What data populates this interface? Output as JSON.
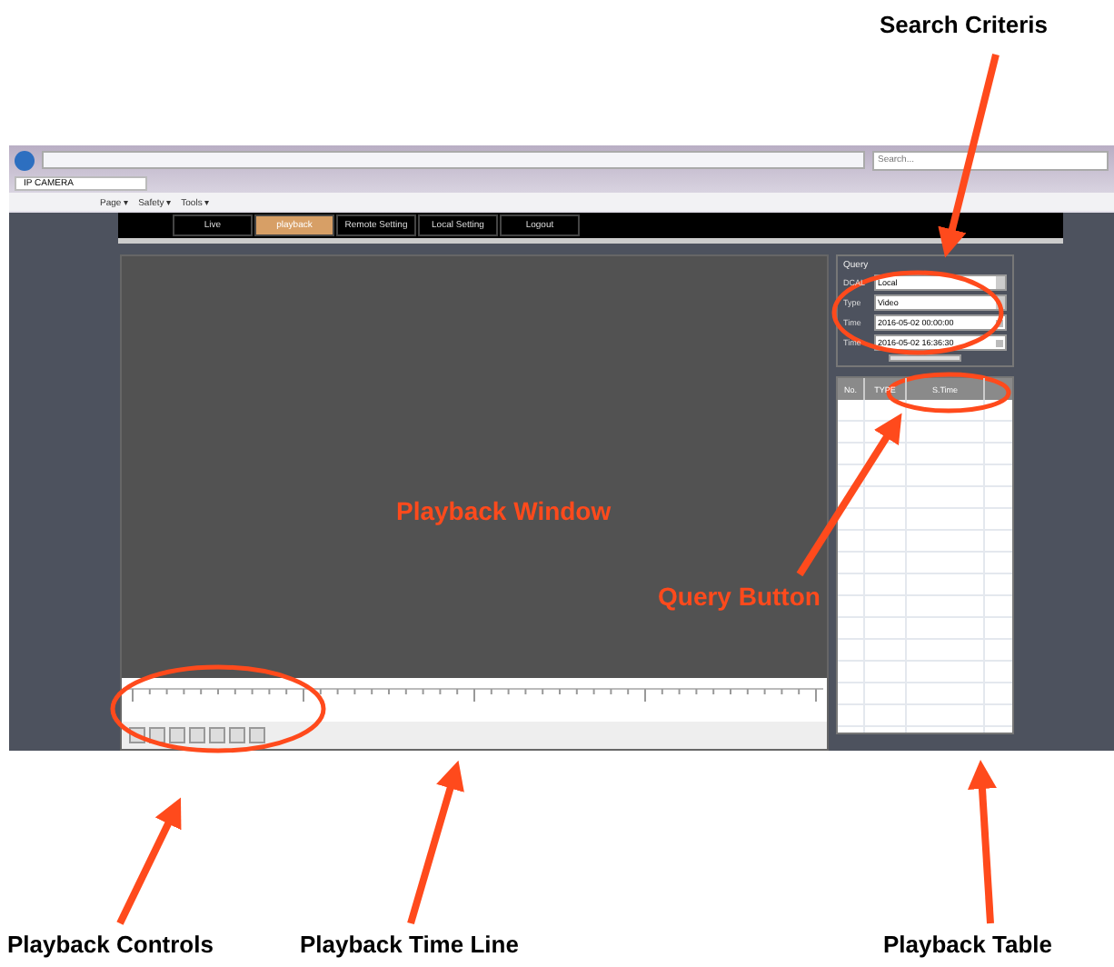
{
  "browser": {
    "tab_title": "IP CAMERA",
    "search": {
      "placeholder": "Search..."
    },
    "menu": [
      "Page ▾",
      "Safety ▾",
      "Tools ▾"
    ]
  },
  "nav": [
    {
      "label": "Live",
      "selected": false
    },
    {
      "label": "playback",
      "selected": true
    },
    {
      "label": "Remote Setting",
      "selected": false
    },
    {
      "label": "Local Setting",
      "selected": false
    },
    {
      "label": "Logout",
      "selected": false
    }
  ],
  "query": {
    "title": "Query",
    "fields": [
      {
        "label": "DCAL",
        "value": "Local",
        "kind": "select"
      },
      {
        "label": "Type",
        "value": "Video",
        "kind": "select"
      },
      {
        "label": "Time",
        "value": "2016-05-02 00:00:00",
        "kind": "time"
      },
      {
        "label": "Time",
        "value": "2016-05-02 16:36:30",
        "kind": "time"
      }
    ]
  },
  "table": {
    "columns": [
      "No.",
      "TYPE",
      "S.Time"
    ]
  },
  "annotations": [
    {
      "text": "Search Criteris",
      "kind": "caption"
    },
    {
      "text": "Playback Window",
      "kind": "overlay"
    },
    {
      "text": "Query Button",
      "kind": "overlay"
    },
    {
      "text": "Playback Controls",
      "kind": "caption"
    },
    {
      "text": "Playback Time Line",
      "kind": "caption"
    },
    {
      "text": "Playback Table",
      "kind": "caption"
    }
  ]
}
